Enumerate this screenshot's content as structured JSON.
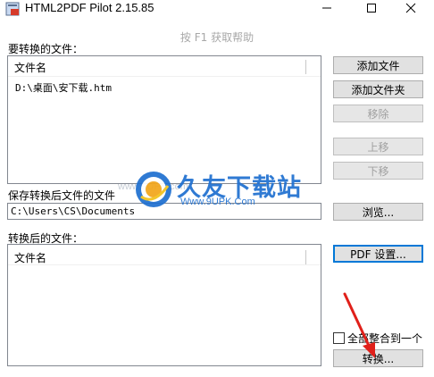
{
  "window": {
    "title": "HTML2PDF Pilot 2.15.85",
    "help_hint": "按 F1 获取帮助"
  },
  "source_section": {
    "label": "要转换的文件：",
    "column_header": "文件名",
    "files": [
      "D:\\桌面\\安下载.htm"
    ]
  },
  "buttons": {
    "add_file": "添加文件",
    "add_folder": "添加文件夹",
    "remove": "移除",
    "move_up": "上移",
    "move_down": "下移",
    "browse": "浏览...",
    "pdf_settings": "PDF 设置...",
    "convert": "转换..."
  },
  "save_section": {
    "label": "保存转换后文件的文件",
    "path": "C:\\Users\\CS\\Documents"
  },
  "output_section": {
    "label": "转换后的文件：",
    "column_header": "文件名"
  },
  "merge_option": {
    "label": "全部整合到一个",
    "checked": false
  },
  "watermark": {
    "brand": "久友下载站",
    "url": "Www.9UPK.Com",
    "faint": "www.9UPK.com"
  },
  "colors": {
    "accent": "#0078d7",
    "watermark_blue": "#1e6fd0",
    "arrow_red": "#e0201a"
  }
}
